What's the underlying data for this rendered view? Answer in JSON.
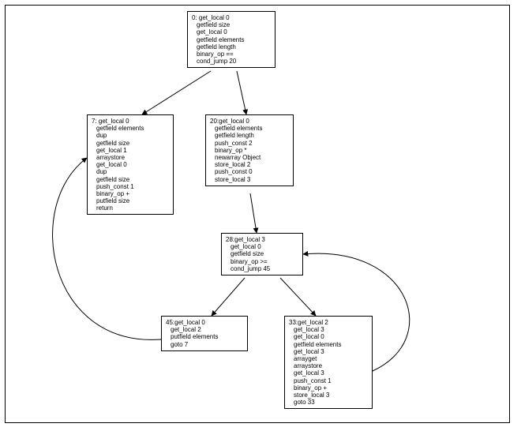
{
  "nodes": {
    "n0": {
      "header": "0: get_local 0",
      "lines": [
        "getfield size",
        "get_local 0",
        "getfield elements",
        "getfield length",
        "binary_op ==",
        "cond_jump 20"
      ]
    },
    "n7": {
      "header": "7: get_local 0",
      "lines": [
        "getfield elements",
        "dup",
        "getfield size",
        "get_local 1",
        "arraystore",
        "get_local 0",
        "dup",
        "getfield size",
        "push_const 1",
        "binary_op +",
        "putfield size",
        "return"
      ]
    },
    "n20": {
      "header": "20:get_local 0",
      "lines": [
        "getfield elements",
        "getfield length",
        "push_const 2",
        "binary_op *",
        "newarray Object",
        "store_local 2",
        "push_const 0",
        "store_local 3"
      ]
    },
    "n28": {
      "header": "28:get_local 3",
      "lines": [
        "get_local 0",
        "getfield size",
        "binary_op >=",
        "cond_jump 45"
      ]
    },
    "n45": {
      "header": "45:get_local 0",
      "lines": [
        "get_local 2",
        "putfield elements",
        "goto 7"
      ]
    },
    "n33": {
      "header": "33:get_local 2",
      "lines": [
        "get_local 3",
        "get_local 0",
        "getfield elements",
        "get_local 3",
        "arrayget",
        "arraystore",
        "get_local 3",
        "push_const 1",
        "binary_op +",
        "store_local 3",
        "goto 33"
      ]
    }
  },
  "edges": [
    {
      "from": "n0",
      "to": "n7"
    },
    {
      "from": "n0",
      "to": "n20"
    },
    {
      "from": "n20",
      "to": "n28"
    },
    {
      "from": "n28",
      "to": "n45"
    },
    {
      "from": "n28",
      "to": "n33"
    },
    {
      "from": "n45",
      "to": "n7",
      "kind": "curve-left"
    },
    {
      "from": "n33",
      "to": "n28",
      "kind": "curve-right"
    }
  ]
}
